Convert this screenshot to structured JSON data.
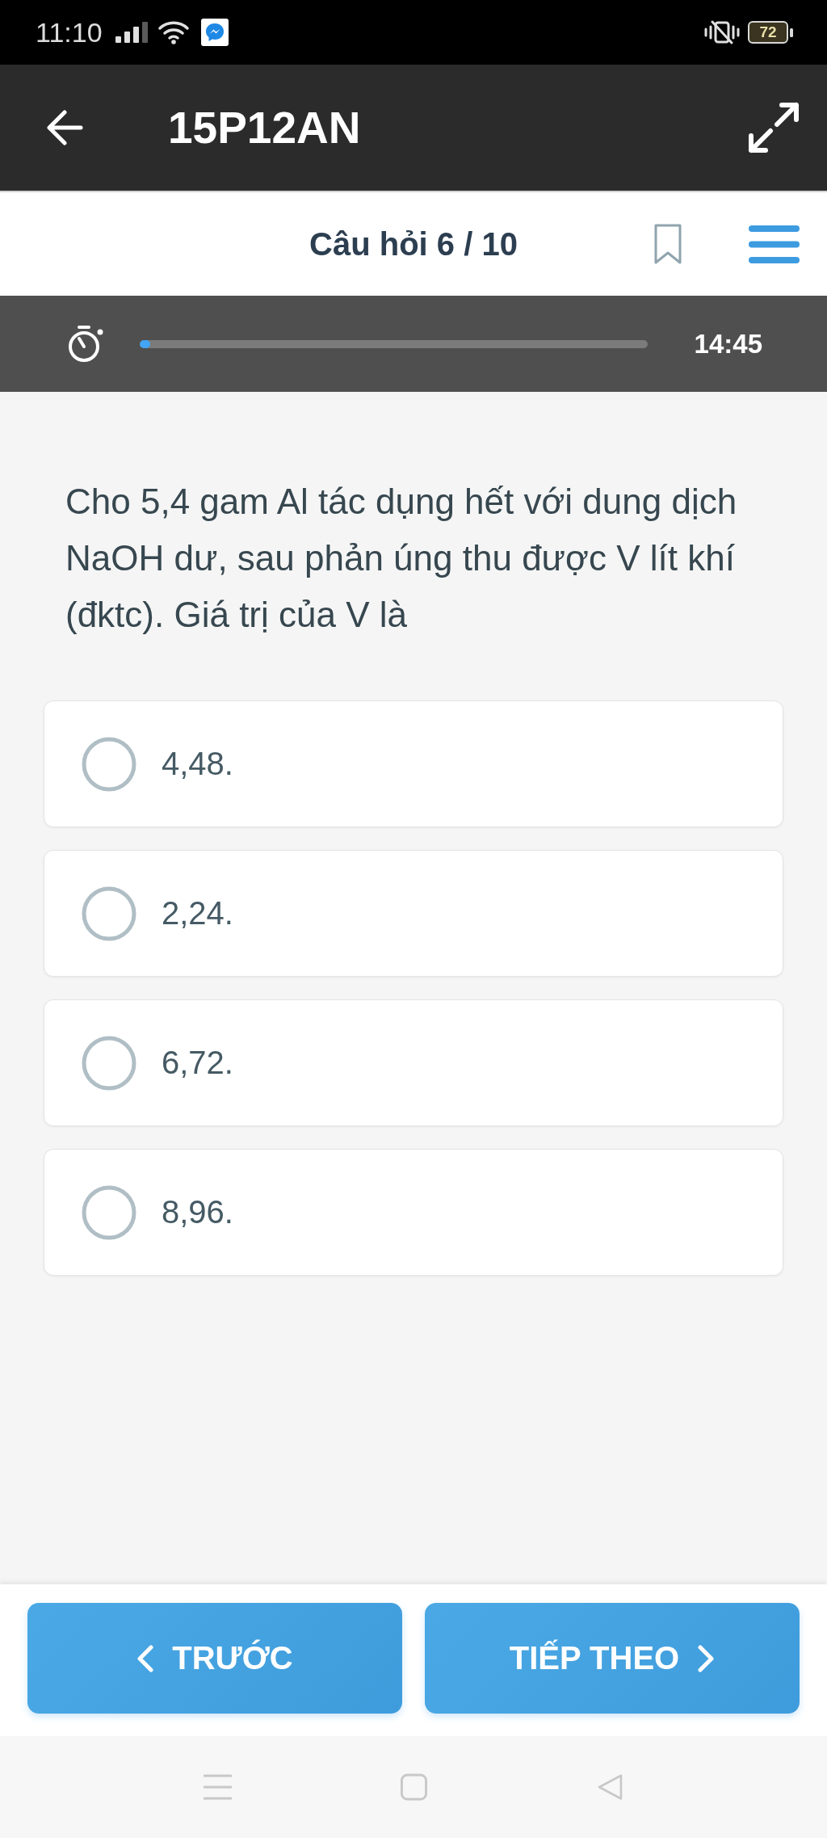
{
  "status_bar": {
    "time": "11:10",
    "battery": "72"
  },
  "app_bar": {
    "title": "15P12AN"
  },
  "question_bar": {
    "counter": "Câu hỏi 6 / 10"
  },
  "timer": {
    "level": 0.02,
    "time": "14:45"
  },
  "question": {
    "text": "Cho 5,4 gam Al tác dụng hết với dung dịch NaOH dư, sau phản úng thu được V lít khí (đktc). Giá trị của V là"
  },
  "options": [
    {
      "label": "4,48.",
      "selected": false
    },
    {
      "label": "2,24.",
      "selected": false
    },
    {
      "label": "6,72.",
      "selected": false
    },
    {
      "label": "8,96.",
      "selected": false
    }
  ],
  "navigation": [
    {
      "kind": "previous",
      "label": "TRƯỚC"
    },
    {
      "kind": "next",
      "label": "TIẾP THEO"
    }
  ]
}
